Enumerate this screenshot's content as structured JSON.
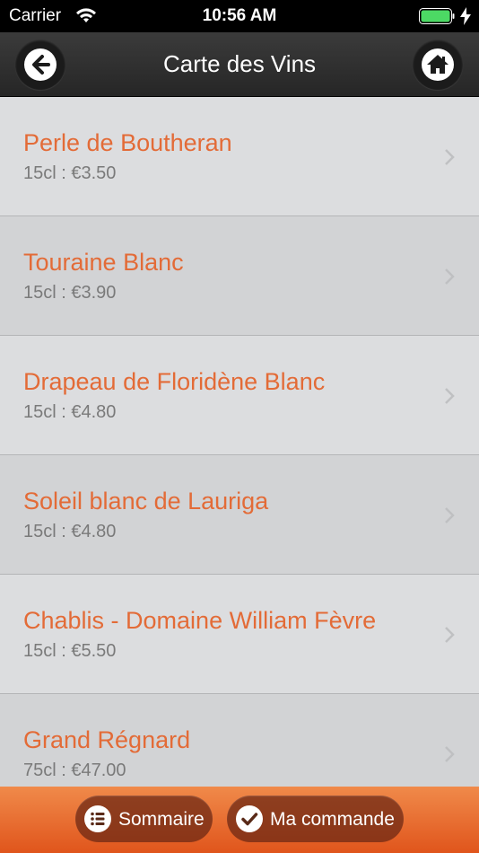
{
  "status": {
    "carrier": "Carrier",
    "time": "10:56 AM"
  },
  "nav": {
    "title": "Carte des Vins",
    "back_icon": "back-arrow-icon",
    "home_icon": "home-icon"
  },
  "wines": [
    {
      "name": "Perle de Boutheran",
      "price": "15cl : €3.50"
    },
    {
      "name": "Touraine Blanc",
      "price": "15cl : €3.90"
    },
    {
      "name": "Drapeau de Floridène Blanc",
      "price": "15cl : €4.80"
    },
    {
      "name": "Soleil blanc de Lauriga",
      "price": "15cl : €4.80"
    },
    {
      "name": "Chablis - Domaine William Fèvre",
      "price": "15cl : €5.50"
    },
    {
      "name": "Grand Régnard",
      "price": "75cl : €47.00"
    }
  ],
  "bottom": {
    "sommaire_label": "Sommaire",
    "commande_label": "Ma commande"
  },
  "colors": {
    "accent": "#e36b37",
    "price": "#7a7a7a",
    "bottom_bar": "#e8692f"
  }
}
